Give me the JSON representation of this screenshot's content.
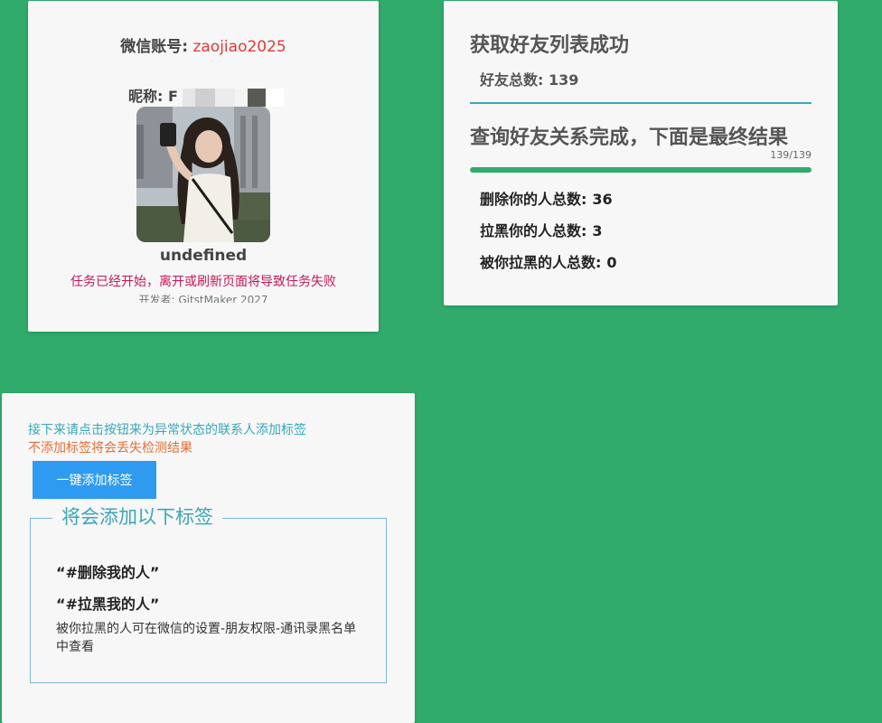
{
  "profile": {
    "account_label": "微信账号:",
    "account_value": "zaojiao2025",
    "nickname_label": "昵称: F",
    "nickname_text": "undefined",
    "task_warning": "任务已经开始，离开或刷新页面将导致任务失败",
    "author_line": "开发者: GitstMaker 2027"
  },
  "result": {
    "fetch_title": "获取好友列表成功",
    "friend_total_label": "好友总数:",
    "friend_total_value": "139",
    "query_title": "查询好友关系完成，下面是最终结果",
    "progress_text": "139/139",
    "progress_fraction": 1.0,
    "stats": [
      {
        "label": "删除你的人总数:",
        "value": "36"
      },
      {
        "label": "拉黑你的人总数:",
        "value": "3"
      },
      {
        "label": "被你拉黑的人总数:",
        "value": "0"
      }
    ]
  },
  "tags": {
    "hint_1": "接下来请点击按钮来为异常状态的联系人添加标签",
    "hint_2": "不添加标签将会丢失检测结果",
    "add_button": "一键添加标签",
    "box_title": "将会添加以下标签",
    "tag_deleted": "“#删除我的人”",
    "tag_blocked": "“#拉黑我的人”",
    "note": "被你拉黑的人可在微信的设置-朋友权限-通讯录黑名单中查看"
  },
  "colors": {
    "background": "#31ab6c",
    "accent_blue": "#2f9bf0",
    "teal": "#3aa7b8",
    "warning_red": "#e03a3a"
  }
}
